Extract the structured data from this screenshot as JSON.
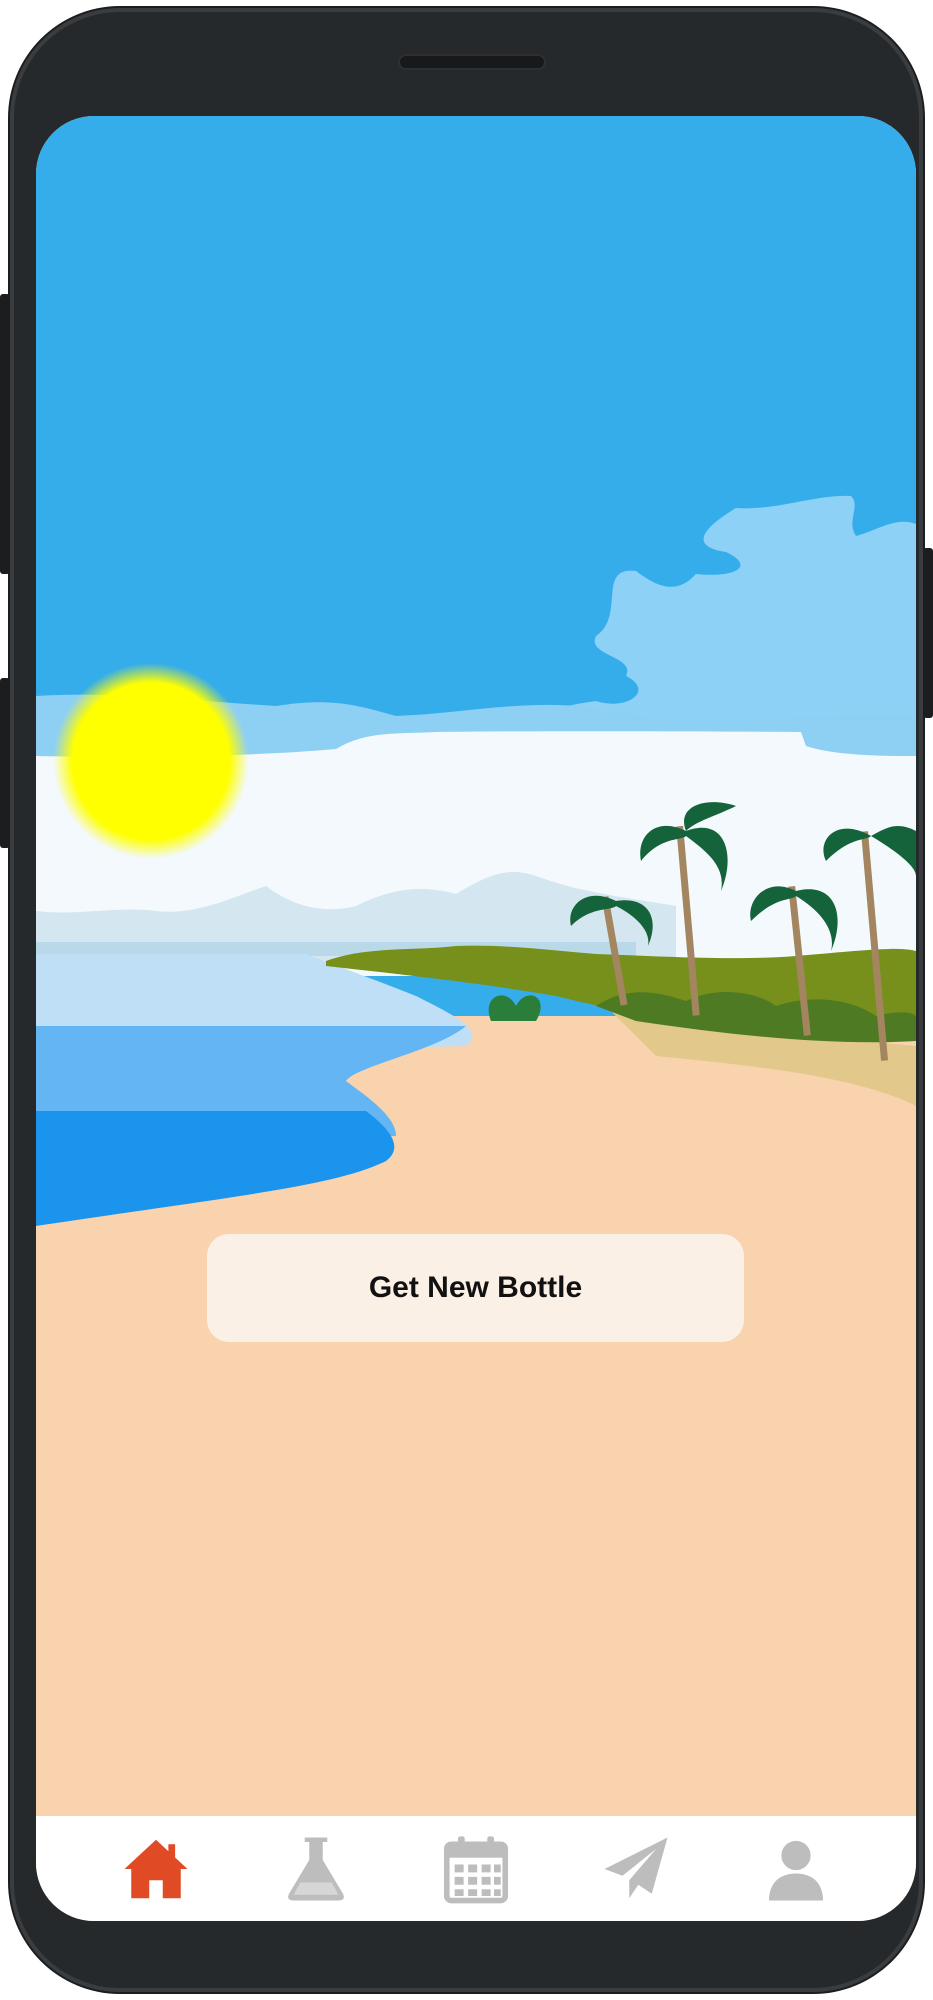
{
  "app": {
    "primary_button_label": "Get New Bottle"
  },
  "colors": {
    "sky": "#35adeb",
    "sun": "#ffff00",
    "sand": "#f9d3ae",
    "sea_deep": "#1b94ee",
    "button_bg": "#fbf0e6",
    "tab_active": "#e04a24",
    "tab_inactive": "#bdbdbd"
  },
  "tabs": [
    {
      "id": "home",
      "icon": "home-icon",
      "active": true
    },
    {
      "id": "lab",
      "icon": "flask-icon",
      "active": false
    },
    {
      "id": "calendar",
      "icon": "calendar-icon",
      "active": false
    },
    {
      "id": "send",
      "icon": "paper-plane-icon",
      "active": false
    },
    {
      "id": "profile",
      "icon": "user-icon",
      "active": false
    }
  ]
}
